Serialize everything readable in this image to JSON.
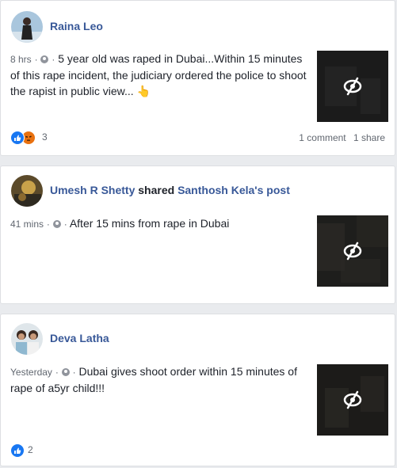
{
  "colors": {
    "page_bg": "#e9ebee",
    "card_bg": "#ffffff",
    "author_link": "#385898",
    "like_blue": "#1877f2",
    "angry_orange": "#e9710f",
    "muted": "#616770"
  },
  "posts": [
    {
      "author": "Raina Leo",
      "time": "8 hrs",
      "separator": "·",
      "privacy_icon": "globe-icon",
      "text": "5 year old was raped in Dubai...Within 15 minutes of this rape incident, the judiciary ordered the police to shoot the rapist in public view...",
      "emoji": "👆",
      "thumbnail_icon": "eye-slash-icon",
      "reactions": [
        "like",
        "angry"
      ],
      "reaction_count": "3",
      "comments": "1 comment",
      "shares": "1 share"
    },
    {
      "author": "Umesh R Shetty",
      "shared_word": "shared",
      "shared_target": "Santhosh Kela's post",
      "time": "41 mins",
      "separator": "·",
      "privacy_icon": "globe-icon",
      "text": "After 15 mins from rape in Dubai",
      "thumbnail_icon": "eye-slash-icon"
    },
    {
      "author": "Deva Latha",
      "time": "Yesterday",
      "separator": "·",
      "privacy_icon": "globe-icon",
      "text": "Dubai gives shoot order within 15 minutes of rape of a5yr child!!!",
      "thumbnail_icon": "eye-slash-icon",
      "reactions": [
        "like"
      ],
      "reaction_count": "2"
    }
  ]
}
